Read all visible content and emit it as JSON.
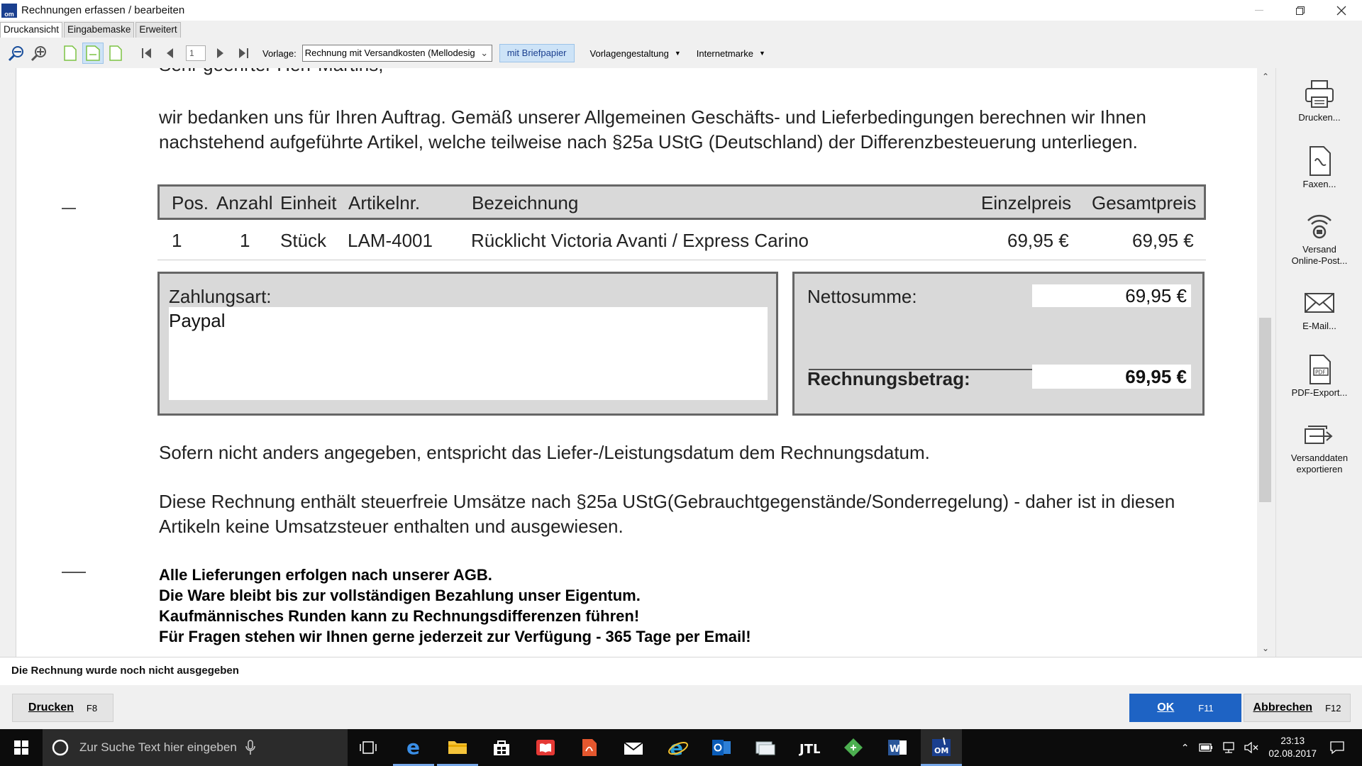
{
  "window": {
    "title": "Rechnungen erfassen / bearbeiten"
  },
  "tabs": [
    {
      "label": "Druckansicht",
      "active": true
    },
    {
      "label": "Eingabemaske",
      "active": false
    },
    {
      "label": "Erweitert",
      "active": false
    }
  ],
  "toolbar": {
    "page_number": "1",
    "vorlage_label": "Vorlage:",
    "vorlage_value": "Rechnung mit Versandkosten (Mellodesig",
    "briefpapier_label": "mit Briefpapier",
    "vorlagengestaltung_label": "Vorlagengestaltung",
    "internetmarke_label": "Internetmarke"
  },
  "document": {
    "salutation": "Sehr geehrter Herr Martins,",
    "intro_line1": "wir bedanken uns für Ihren Auftrag. Gemäß unserer Allgemeinen Geschäfts- und Lieferbedingungen berechnen wir Ihnen",
    "intro_line2": "nachstehend aufgeführte Artikel, welche teilweise nach §25a UStG (Deutschland) der Differenzbesteuerung unterliegen.",
    "table": {
      "headers": {
        "pos": "Pos.",
        "anzahl": "Anzahl",
        "einheit": "Einheit",
        "artikelnr": "Artikelnr.",
        "bezeichnung": "Bezeichnung",
        "einzelpreis": "Einzelpreis",
        "gesamtpreis": "Gesamtpreis"
      },
      "rows": [
        {
          "pos": "1",
          "anzahl": "1",
          "einheit": "Stück",
          "artikelnr": "LAM-4001",
          "bezeichnung": "Rücklicht Victoria Avanti / Express Carino",
          "einzelpreis": "69,95 €",
          "gesamtpreis": "69,95 €"
        }
      ]
    },
    "payment": {
      "label": "Zahlungsart:",
      "value": "Paypal"
    },
    "totals": {
      "netto_label": "Nettosumme:",
      "netto_value": "69,95 €",
      "rechnungsbetrag_label": "Rechnungsbetrag:",
      "rechnungsbetrag_value": "69,95 €"
    },
    "note_delivery": "Sofern nicht anders angegeben, entspricht das Liefer-/Leistungsdatum dem Rechnungsdatum.",
    "note_tax_line1": "Diese Rechnung enthält steuerfreie Umsätze nach §25a UStG(Gebrauchtgegenstände/Sonderregelung) - daher ist in diesen",
    "note_tax_line2": "Artikeln keine Umsatzsteuer enthalten und ausgewiesen.",
    "bold_notes": [
      "Alle Lieferungen erfolgen nach unserer AGB.",
      "Die Ware bleibt bis zur vollständigen Bezahlung unser Eigentum.",
      "Kaufmännisches Runden kann zu Rechnungsdifferenzen führen!",
      "Für Fragen stehen wir Ihnen gerne jederzeit zur Verfügung - 365 Tage per Email!"
    ]
  },
  "actions": {
    "drucken": "Drucken...",
    "faxen": "Faxen...",
    "versand_line1": "Versand",
    "versand_line2": "Online-Post...",
    "email": "E-Mail...",
    "pdf": "PDF-Export...",
    "versanddaten_line1": "Versanddaten",
    "versanddaten_line2": "exportieren"
  },
  "status_text": "Die Rechnung wurde noch nicht ausgegeben",
  "footer": {
    "drucken_label": "Drucken",
    "drucken_key": "F8",
    "ok_label": "OK",
    "ok_key": "F11",
    "abbrechen_label": "Abbrechen",
    "abbrechen_key": "F12"
  },
  "taskbar": {
    "search_placeholder": "Zur Suche Text hier eingeben",
    "time": "23:13",
    "date": "02.08.2017"
  },
  "colors": {
    "accent": "#1e63c4",
    "selected_bg": "#cde3f7",
    "table_gray": "#d9d9d9"
  }
}
